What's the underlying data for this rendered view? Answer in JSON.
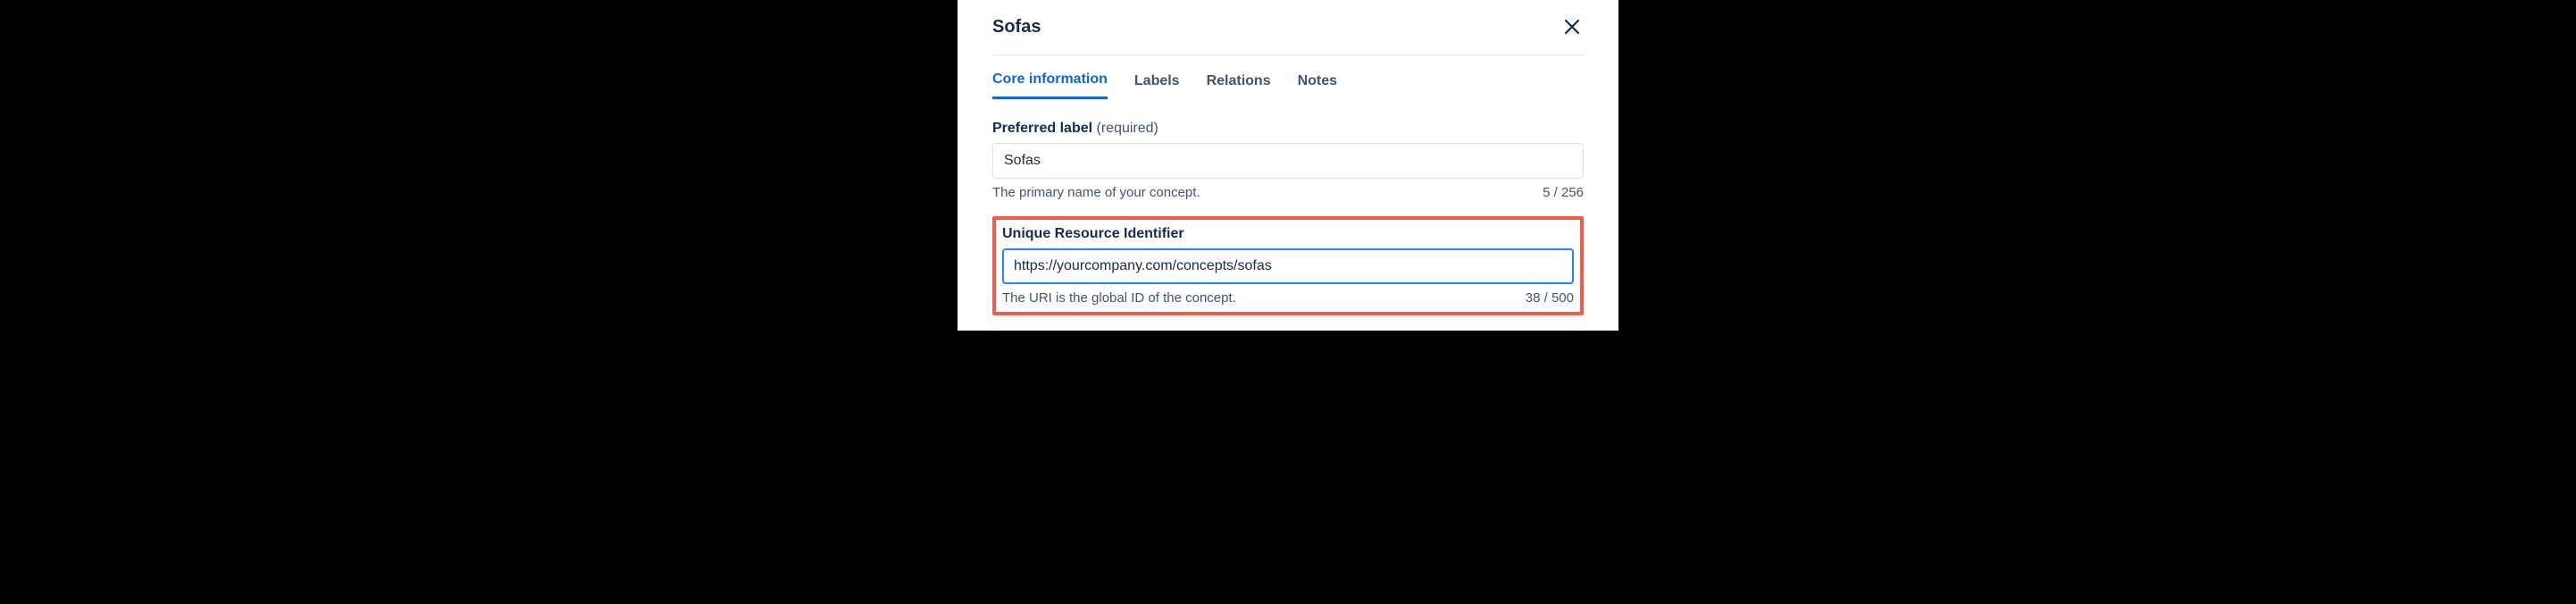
{
  "header": {
    "title": "Sofas"
  },
  "tabs": {
    "core": "Core information",
    "labels": "Labels",
    "relations": "Relations",
    "notes": "Notes"
  },
  "fields": {
    "preferredLabel": {
      "label": "Preferred label",
      "required": "(required)",
      "value": "Sofas",
      "helper": "The primary name of your concept.",
      "count": "5 / 256"
    },
    "uri": {
      "label": "Unique Resource Identifier",
      "value": "https://yourcompany.com/concepts/sofas",
      "helper": "The URI is the global ID of the concept.",
      "count": "38 / 500"
    }
  }
}
